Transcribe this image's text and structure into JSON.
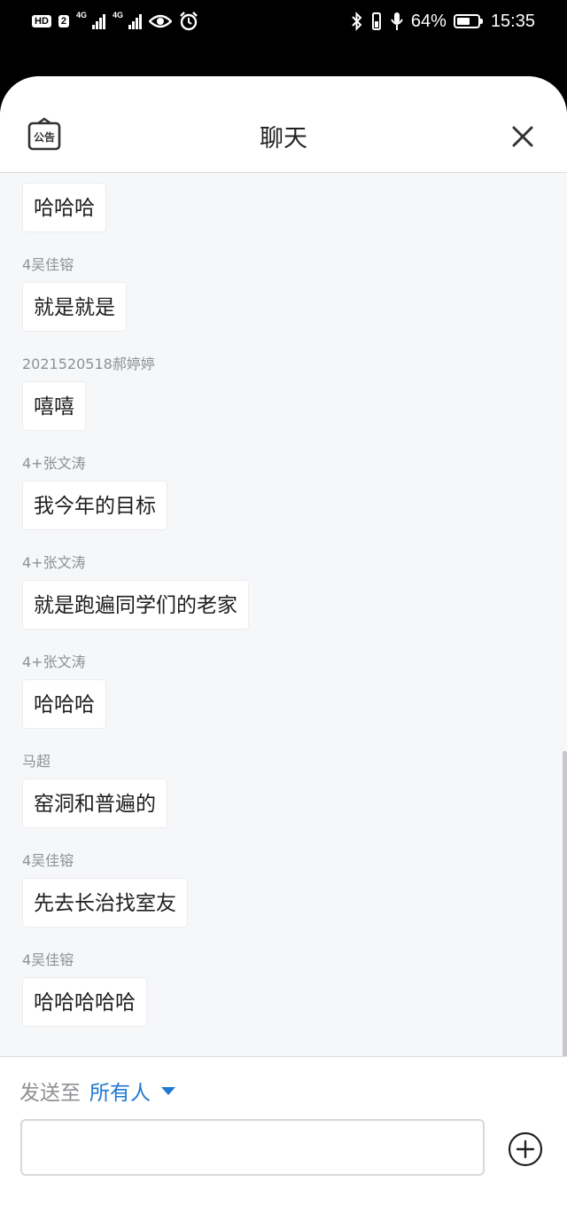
{
  "status_bar": {
    "hd_label": "HD",
    "sim_label": "2",
    "net1": "4G",
    "net2": "4G",
    "battery_percent": "64%",
    "battery_level": 0.64,
    "time": "15:35"
  },
  "header": {
    "notice_label": "公告",
    "title": "聊天"
  },
  "messages": [
    {
      "sender": "",
      "text": "哈哈哈"
    },
    {
      "sender": "4吴佳镕",
      "text": "就是就是"
    },
    {
      "sender": "2021520518郝婷婷",
      "text": "嘻嘻"
    },
    {
      "sender": "4+张文涛",
      "text": "我今年的目标"
    },
    {
      "sender": "4+张文涛",
      "text": "就是跑遍同学们的老家"
    },
    {
      "sender": "4+张文涛",
      "text": "哈哈哈"
    },
    {
      "sender": "马超",
      "text": "窑洞和普遍的"
    },
    {
      "sender": "4吴佳镕",
      "text": "先去长治找室友"
    },
    {
      "sender": "4吴佳镕",
      "text": "哈哈哈哈哈"
    }
  ],
  "composer": {
    "send_to_label": "发送至",
    "send_to_target": "所有人",
    "input_value": "",
    "input_placeholder": ""
  },
  "colors": {
    "accent": "#1f78d1",
    "background": "#f6f7f9",
    "sender_text": "#8e9095"
  },
  "icons": [
    "notice-board-icon",
    "close-icon",
    "plus-circle-icon",
    "caret-down-icon",
    "bluetooth-icon",
    "microphone-icon",
    "eye-icon",
    "alarm-icon"
  ]
}
